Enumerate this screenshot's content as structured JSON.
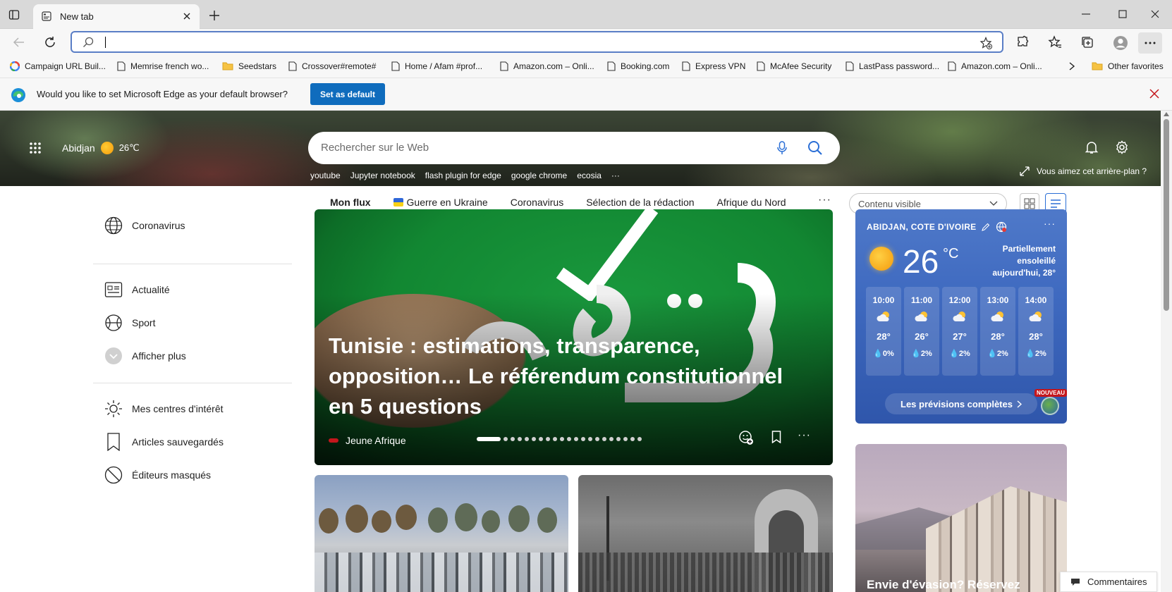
{
  "browser": {
    "tab_title": "New tab",
    "address_value": "",
    "bookmarks": [
      {
        "label": "Campaign URL Buil...",
        "icon": "google-icon"
      },
      {
        "label": "Memrise french wo...",
        "icon": "page-icon"
      },
      {
        "label": "Seedstars",
        "icon": "folder-icon"
      },
      {
        "label": "Crossover#remote#",
        "icon": "page-icon"
      },
      {
        "label": "Home / Afam #prof...",
        "icon": "page-icon"
      },
      {
        "label": "Amazon.com – Onli...",
        "icon": "page-icon"
      },
      {
        "label": "Booking.com",
        "icon": "page-icon"
      },
      {
        "label": "Express VPN",
        "icon": "page-icon"
      },
      {
        "label": "McAfee Security",
        "icon": "page-icon"
      },
      {
        "label": "LastPass password...",
        "icon": "page-icon"
      },
      {
        "label": "Amazon.com – Onli...",
        "icon": "page-icon"
      }
    ],
    "other_favorites": "Other favorites",
    "infobar": {
      "message": "Would you like to set Microsoft Edge as your default browser?",
      "button": "Set as default"
    }
  },
  "hero": {
    "city": "Abidjan",
    "temp": "26℃",
    "search_placeholder": "Rechercher sur le Web",
    "quick_links": [
      "youtube",
      "Jupyter notebook",
      "flash plugin for edge",
      "google chrome",
      "ecosia"
    ],
    "like_background": "Vous aimez cet arrière-plan ?"
  },
  "feed_nav": {
    "items": [
      "Mon flux",
      "Guerre en Ukraine",
      "Coronavirus",
      "Sélection de la rédaction",
      "Afrique du Nord"
    ],
    "view_select": "Contenu visible"
  },
  "left_nav": {
    "coronavirus": "Coronavirus",
    "news": "Actualité",
    "sport": "Sport",
    "show_more": "Afficher plus",
    "interests": "Mes centres d'intérêt",
    "saved": "Articles sauvegardés",
    "hidden": "Éditeurs masqués"
  },
  "main_story": {
    "headline": "Tunisie : estimations, transparence, opposition… Le référendum constitutionnel en 5 questions",
    "source": "Jeune Afrique",
    "carousel_count": 21,
    "carousel_active": 0
  },
  "weather": {
    "location": "ABIDJAN, COTE D'IVOIRE",
    "temp": "26",
    "unit": "°C",
    "condition": "Partiellement ensoleillé aujourd'hui, 28°",
    "hours": [
      {
        "time": "10:00",
        "temp": "28°",
        "precip": "0%"
      },
      {
        "time": "11:00",
        "temp": "26°",
        "precip": "2%"
      },
      {
        "time": "12:00",
        "temp": "27°",
        "precip": "2%"
      },
      {
        "time": "13:00",
        "temp": "28°",
        "precip": "2%"
      },
      {
        "time": "14:00",
        "temp": "28°",
        "precip": "2%"
      }
    ],
    "full_forecast": "Les prévisions complètes",
    "badge": "NOUVEAU"
  },
  "travel_card": {
    "caption": "Envie d'évasion? Réservez"
  },
  "feedback": "Commentaires",
  "colors": {
    "accent": "#0f6cbd",
    "weather_bg": "#3f6ac0",
    "close_red": "#c4161c"
  }
}
